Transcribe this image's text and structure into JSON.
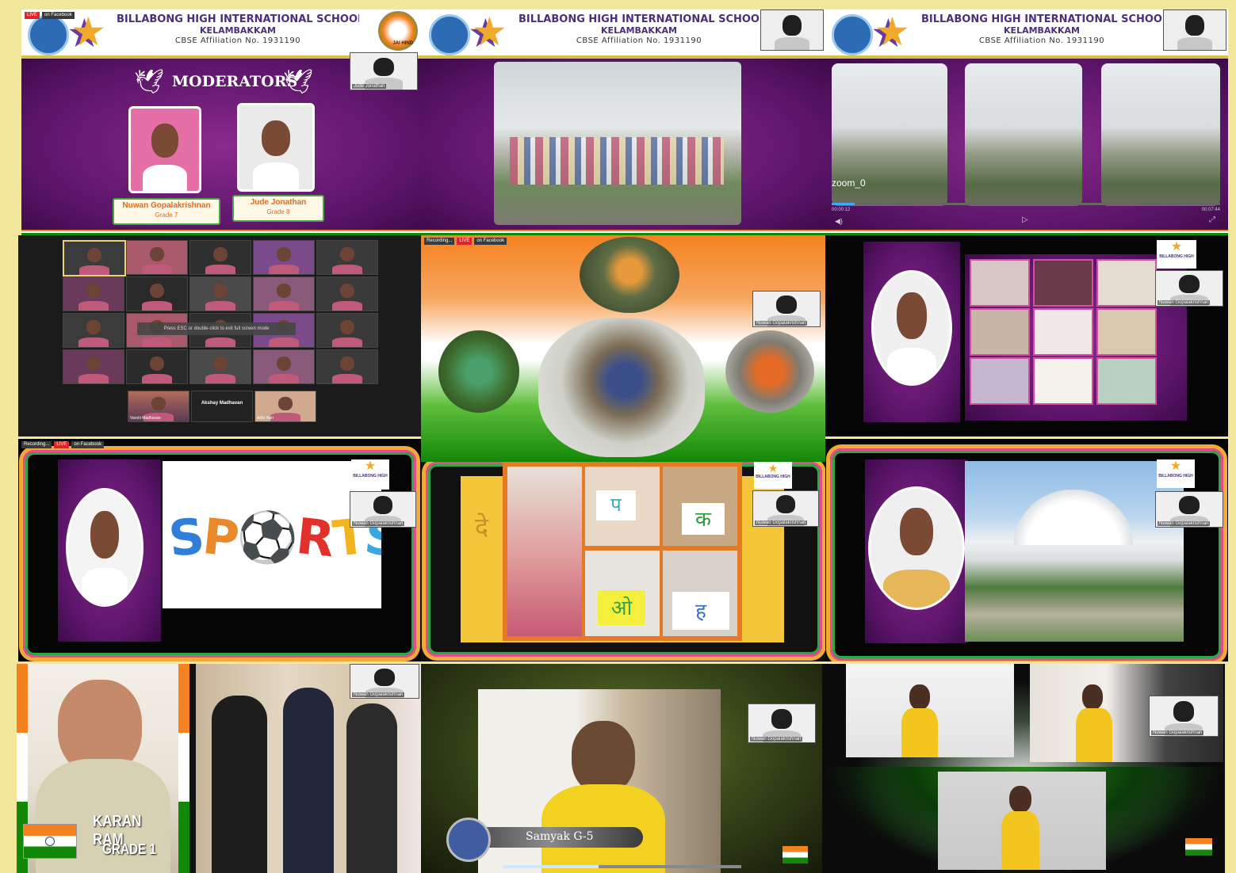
{
  "banner": {
    "line1": "BILLABONG HIGH INTERNATIONAL SCHOOL",
    "line1_cut": "BILLABONG HIGH INTERNATIONAL SCHOO",
    "line2": "KELAMBAKKAM",
    "line3": "CBSE Affiliation No. 1931190",
    "jai_hind": "JAI HIND"
  },
  "recording": {
    "live": "LIVE",
    "fb": "on Facebook",
    "rec": "Recording..."
  },
  "moderators": {
    "title": "MODERATORS",
    "people": [
      {
        "name": "Nuwan Gopalakrishnan",
        "grade": "Grade 7"
      },
      {
        "name": "Jude Jonathan",
        "grade": "Grade 8"
      }
    ],
    "cam_label": "Jude Jonathan"
  },
  "video_player": {
    "caption": "zoom_0",
    "elapsed": "00:00:12",
    "total": "00:07:44"
  },
  "gallery": {
    "tooltip": "Press ESC or double-click to exit full screen mode",
    "bottom_name": "Akshay Madhavan",
    "tile_labels": [
      "Jude Jonathan",
      "Varshi Madhavan",
      "Arthi Hari"
    ]
  },
  "cam_name": "Nuwan Gopalakrishnan",
  "sports_text": "SPORTS",
  "hindi": {
    "side_char": "दे",
    "cards": [
      "प",
      "क",
      "ओ",
      "ह"
    ]
  },
  "karan": {
    "name": "KARAN RAM",
    "grade": "GRADE 1"
  },
  "samyak": {
    "caption": "Samyak G-5"
  },
  "logo_text": "BILLABONG HIGH",
  "colors": {
    "purple": "#5a1468",
    "saffron": "#f58220",
    "green": "#138808",
    "banner_text": "#4b2f7a",
    "background": "#f3e79b"
  }
}
